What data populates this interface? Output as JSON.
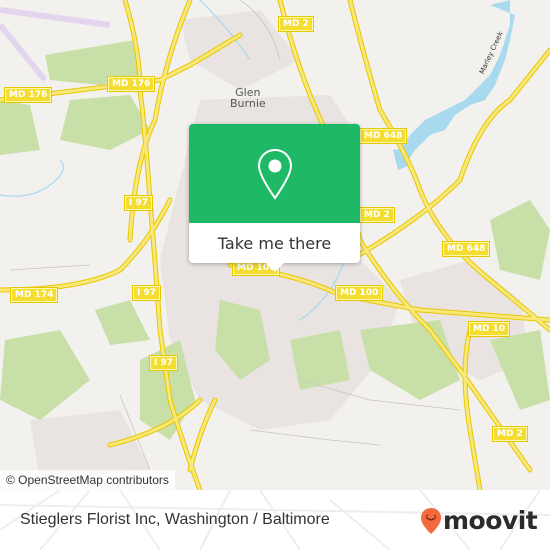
{
  "map": {
    "place_labels": [
      {
        "name": "Glen Burnie",
        "line1": "Glen",
        "line2": "Burnie"
      }
    ],
    "water_labels": [
      "Marley Creek"
    ],
    "road_shields": [
      {
        "id": "md2-top",
        "label": "MD 2"
      },
      {
        "id": "md176-left",
        "label": "MD 176"
      },
      {
        "id": "md176-mid",
        "label": "MD 176"
      },
      {
        "id": "md648-top",
        "label": "MD 648"
      },
      {
        "id": "i97-upper",
        "label": "I 97"
      },
      {
        "id": "md2-mid",
        "label": "MD 2"
      },
      {
        "id": "md648-right",
        "label": "MD 648"
      },
      {
        "id": "md174",
        "label": "MD 174"
      },
      {
        "id": "i97-mid",
        "label": "I 97"
      },
      {
        "id": "md100-center",
        "label": "MD 100"
      },
      {
        "id": "md100-right",
        "label": "MD 100"
      },
      {
        "id": "md10",
        "label": "MD 10"
      },
      {
        "id": "i97-lower",
        "label": "I 97"
      },
      {
        "id": "md2-bottom",
        "label": "MD 2"
      }
    ],
    "attribution": "© OpenStreetMap contributors",
    "colors": {
      "land": "#f2f1ee",
      "park": "#c8dfa8",
      "urban": "#e9e3e1",
      "water": "#a9d9ef",
      "road": "#f6df5a",
      "popup_green": "#1fb866"
    }
  },
  "popup": {
    "icon": "location-pin-icon",
    "button_label": "Take me there"
  },
  "footer": {
    "title": "Stieglers Florist Inc, Washington / Baltimore",
    "logo_text": "moovit",
    "logo_icon": "moovit-pin-icon",
    "logo_color": "#f26a3d"
  }
}
